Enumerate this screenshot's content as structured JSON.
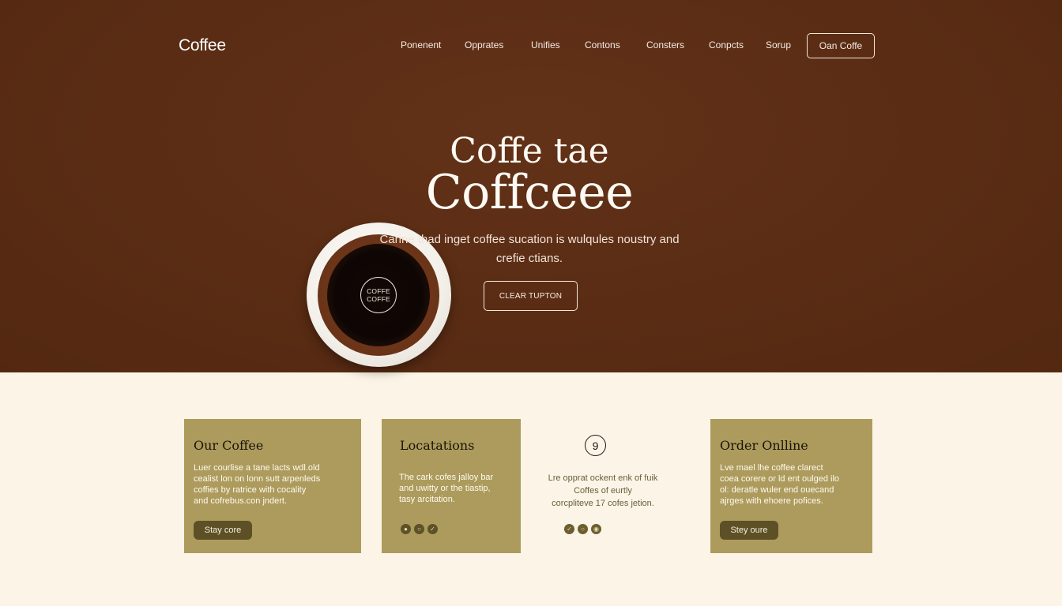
{
  "brand": {
    "logo": "Coffee"
  },
  "nav": {
    "items": [
      "Ponenent",
      "Opprates",
      "Unifies",
      "Contons",
      "Consters",
      "Conpcts",
      "Sorup"
    ],
    "cta": "Oan Coffe"
  },
  "hero": {
    "title_line1": "Coffe tae",
    "title_line2": "Coffceee",
    "subtitle": "Carine thad inget coffee sucation is wulqules noustry and crefie ctians.",
    "button": "CLEAR TUPTON",
    "cup_badge": "COFFE\nCOFFE"
  },
  "cards": [
    {
      "title": "Our Coffee",
      "text": "Luer courlise a tane lacts wdl.old\ncealist lon on lonn sutt arpenleds\ncoffies by ratrice with cocality\nand cofrebus.con jndert.",
      "button": "Stay core"
    },
    {
      "title": "Locatations",
      "text": "The cark cofes jalloy bar\nand uwitty or the tiastip,\ntasy arcitation.",
      "icons": [
        "pin-icon",
        "globe-icon",
        "share-icon"
      ]
    },
    {
      "icon_symbol": "9",
      "text": "Lre opprat ockent enk of fuik\nCoffes of eurtly\ncorcpliteve 17 cofes jetion.",
      "icons": [
        "location-icon",
        "instagram-icon",
        "circle-dot-icon"
      ]
    },
    {
      "title": "Order Onlline",
      "text": "Lve mael lhe coffee clarect\ncoea corere or ld ent oulged ilo\nol: deratle wuler end ouecand\najrges with ehoere pofices.",
      "button": "Stey oure"
    }
  ],
  "colors": {
    "hero_bg": "#5a2c14",
    "page_bg": "#fcf4e6",
    "card_bg": "#ac9b5c",
    "card_button": "#5d5026"
  }
}
